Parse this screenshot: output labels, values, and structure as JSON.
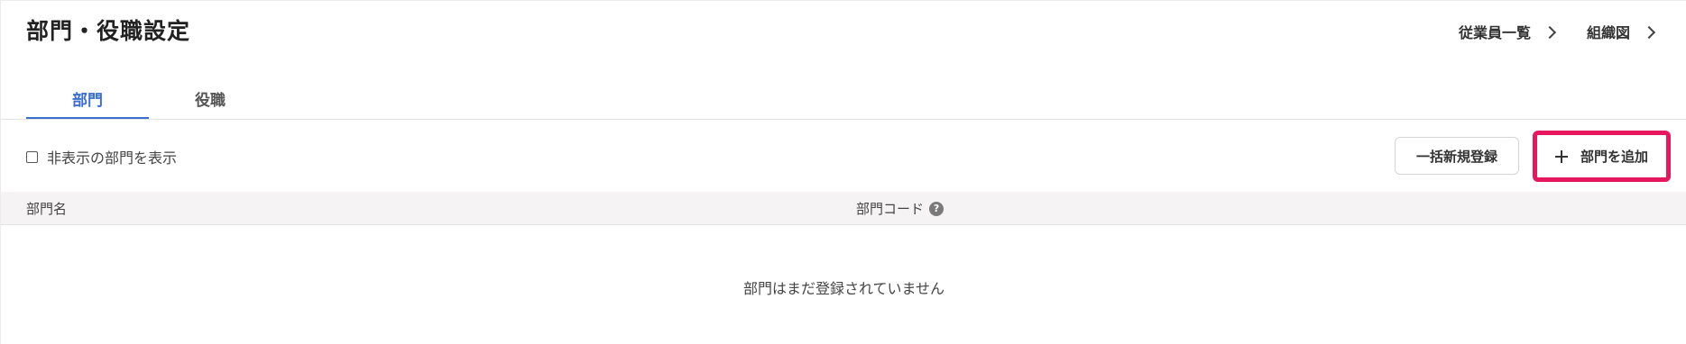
{
  "page": {
    "title": "部門・役職設定"
  },
  "header_links": [
    {
      "label": "従業員一覧",
      "icon": "chevron-right-icon"
    },
    {
      "label": "組織図",
      "icon": "chevron-right-icon"
    }
  ],
  "tabs": [
    {
      "label": "部門",
      "active": true
    },
    {
      "label": "役職",
      "active": false
    }
  ],
  "toolbar": {
    "show_hidden_label": "非表示の部門を表示",
    "show_hidden_checked": false,
    "bulk_register_label": "一括新規登録",
    "add_department_label": "部門を追加",
    "add_icon": "plus-icon",
    "highlight_color": "#e8175d"
  },
  "table": {
    "columns": [
      {
        "label": "部門名"
      },
      {
        "label": "部門コード",
        "help_icon": "?"
      }
    ],
    "empty_message": "部門はまだ登録されていません"
  },
  "colors": {
    "accent": "#3b6fd0",
    "header_bg": "#f5f3f3"
  }
}
